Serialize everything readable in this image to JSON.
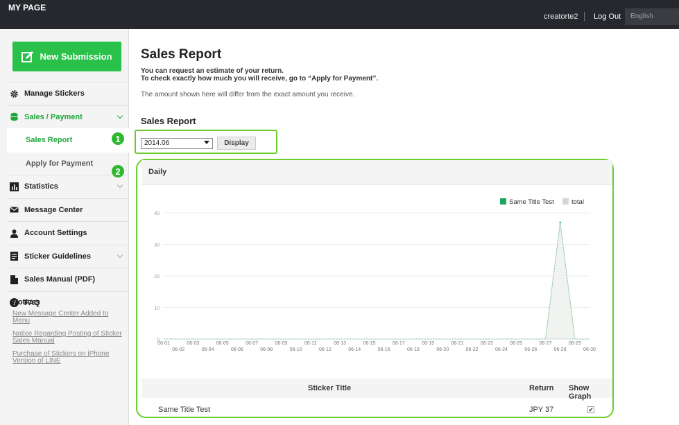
{
  "topbar": {
    "title": "MY PAGE",
    "username": "creatorte2",
    "logout": "Log Out",
    "language": "English"
  },
  "sidebar": {
    "new_submission": "New Submission",
    "items": [
      {
        "label": "Manage Stickers",
        "icon": "gear-icon"
      },
      {
        "label": "Sales / Payment",
        "icon": "coins-icon"
      },
      {
        "label": "Sales Report"
      },
      {
        "label": "Apply for Payment"
      },
      {
        "label": "Statistics",
        "icon": "bar-chart-icon"
      },
      {
        "label": "Message Center",
        "icon": "envelope-icon"
      },
      {
        "label": "Account Settings",
        "icon": "user-icon"
      },
      {
        "label": "Sticker Guidelines",
        "icon": "document-icon"
      },
      {
        "label": "Sales Manual (PDF)",
        "icon": "file-icon"
      },
      {
        "label": "FAQ",
        "icon": "question-icon"
      }
    ],
    "notices_title": "Notices",
    "notices": [
      "New Message Center Added to Menu",
      "Notice Regarding Posting of Sticker Sales Manual",
      "Purchase of Stickers on iPhone Version of LINE"
    ]
  },
  "badges": {
    "one": "1",
    "two": "2"
  },
  "main": {
    "title": "Sales Report",
    "intro_bold_1": "You can request an estimate of your return.",
    "intro_bold_2": "To check exactly how much you will receive, go to “Apply for Payment”.",
    "intro_note": "The amount shown here will differ from the exact amount you receive.",
    "section_title": "Sales Report",
    "period_value": "2014.06",
    "display_button": "Display",
    "panel_title": "Daily"
  },
  "chart_data": {
    "type": "area",
    "x": [
      "06-01",
      "06-02",
      "06-03",
      "06-04",
      "06-05",
      "06-06",
      "06-07",
      "06-08",
      "06-09",
      "06-10",
      "06-11",
      "06-12",
      "06-13",
      "06-14",
      "06-15",
      "06-16",
      "06-17",
      "06-18",
      "06-19",
      "06-20",
      "06-21",
      "06-22",
      "06-23",
      "06-24",
      "06-25",
      "06-26",
      "06-27",
      "06-28",
      "06-29",
      "06-30"
    ],
    "series": [
      {
        "name": "Same Title Test",
        "values": [
          0,
          0,
          0,
          0,
          0,
          0,
          0,
          0,
          0,
          0,
          0,
          0,
          0,
          0,
          0,
          0,
          0,
          0,
          0,
          0,
          0,
          0,
          0,
          0,
          0,
          0,
          0,
          37,
          0,
          0
        ],
        "color": "#1aa760"
      },
      {
        "name": "total",
        "values": [
          0,
          0,
          0,
          0,
          0,
          0,
          0,
          0,
          0,
          0,
          0,
          0,
          0,
          0,
          0,
          0,
          0,
          0,
          0,
          0,
          0,
          0,
          0,
          0,
          0,
          0,
          0,
          37,
          0,
          0
        ],
        "color": "#d4d8d4"
      }
    ],
    "yticks": [
      0,
      10,
      20,
      30,
      40
    ],
    "ylim": [
      0,
      42
    ],
    "legend": "top-right",
    "grid": true
  },
  "table": {
    "headers": {
      "title": "Sticker Title",
      "return": "Return",
      "show_graph": "Show Graph"
    },
    "rows": [
      {
        "title": "Same Title Test",
        "return": "JPY 37",
        "checked": "✔"
      }
    ]
  }
}
